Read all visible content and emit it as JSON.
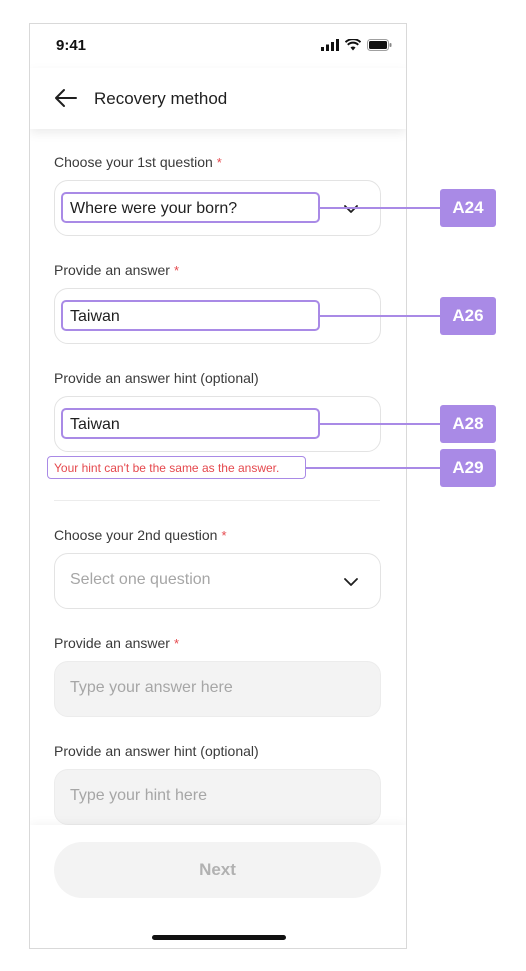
{
  "status": {
    "time": "9:41"
  },
  "header": {
    "title": "Recovery method"
  },
  "q1": {
    "label": "Choose your 1st question",
    "required_mark": "*",
    "selected": "Where were your born?"
  },
  "a1": {
    "label": "Provide an answer",
    "required_mark": "*",
    "value": "Taiwan"
  },
  "h1": {
    "label": "Provide an answer hint (optional)",
    "value": "Taiwan",
    "error": "Your hint can't be the same as the answer."
  },
  "q2": {
    "label": "Choose your 2nd question",
    "required_mark": "*",
    "placeholder": "Select one question"
  },
  "a2": {
    "label": "Provide an answer",
    "required_mark": "*",
    "placeholder": "Type your answer here"
  },
  "h2": {
    "label": "Provide an answer hint (optional)",
    "placeholder": "Type your hint here"
  },
  "footer": {
    "next_label": "Next"
  },
  "annotations": {
    "a24": "A24",
    "a26": "A26",
    "a28": "A28",
    "a29": "A29"
  },
  "colors": {
    "accent": "#a98ae6",
    "error": "#e5484d"
  }
}
